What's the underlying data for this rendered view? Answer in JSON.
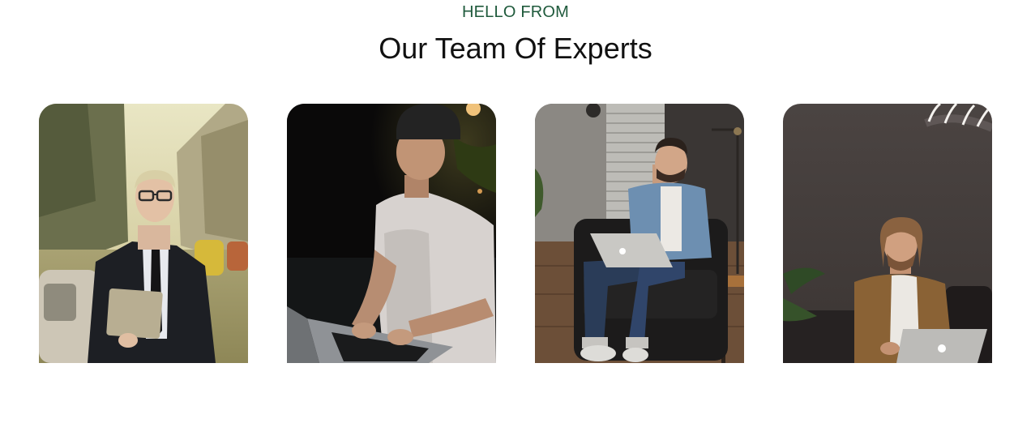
{
  "header": {
    "eyebrow": "HELLO FROM",
    "title": "Our Team Of Experts"
  },
  "team": [
    {
      "photo": "man in black suit holding laptop on city street"
    },
    {
      "photo": "man in beanie typing on laptop in dark room"
    },
    {
      "photo": "man in denim jacket using laptop in armchair"
    },
    {
      "photo": "man with long hair using laptop by neon sign"
    }
  ],
  "colors": {
    "eyebrow": "#1f5a3c",
    "title": "#111111"
  }
}
